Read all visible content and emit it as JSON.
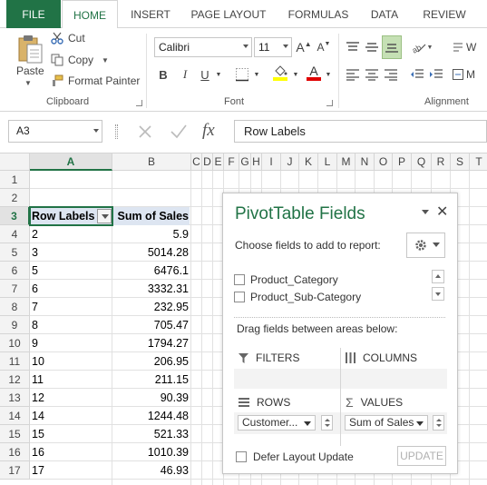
{
  "ribbon_tabs": [
    "FILE",
    "HOME",
    "INSERT",
    "PAGE LAYOUT",
    "FORMULAS",
    "DATA",
    "REVIEW"
  ],
  "active_tab": "HOME",
  "colors": {
    "accent": "#217346",
    "header_cell_fill": "#dde5f1",
    "font_color_bar": "#e00000",
    "highlight_bar": "#ffff00"
  },
  "clipboard": {
    "paste": "Paste",
    "cut": "Cut",
    "copy": "Copy",
    "format_painter": "Format Painter",
    "group_label": "Clipboard"
  },
  "font": {
    "name": "Calibri",
    "size": "11",
    "group_label": "Font",
    "bold": "B",
    "italic": "I",
    "underline": "U",
    "grow": "A",
    "shrink": "A",
    "font_color": "A"
  },
  "alignment": {
    "group_label": "Alignment",
    "wrap_partial": "W",
    "merge_partial": "M"
  },
  "formula_bar": {
    "name_box": "A3",
    "fx": "fx",
    "formula": "Row Labels"
  },
  "columns": [
    "A",
    "B",
    "C",
    "D",
    "E",
    "F",
    "G",
    "H",
    "I",
    "J",
    "K",
    "L",
    "M",
    "N",
    "O",
    "P",
    "Q",
    "R",
    "S",
    "T"
  ],
  "rows": [
    "1",
    "2",
    "3",
    "4",
    "5",
    "6",
    "7",
    "8",
    "9",
    "10",
    "11",
    "12",
    "13",
    "14",
    "15",
    "16",
    "17"
  ],
  "pivot": {
    "header": {
      "label": "Row Labels",
      "value": "Sum of Sales"
    },
    "rows": [
      {
        "label": "2",
        "value": "5.9"
      },
      {
        "label": "3",
        "value": "5014.28"
      },
      {
        "label": "5",
        "value": "6476.1"
      },
      {
        "label": "6",
        "value": "3332.31"
      },
      {
        "label": "7",
        "value": "232.95"
      },
      {
        "label": "8",
        "value": "705.47"
      },
      {
        "label": "9",
        "value": "1794.27"
      },
      {
        "label": "10",
        "value": "206.95"
      },
      {
        "label": "11",
        "value": "211.15"
      },
      {
        "label": "12",
        "value": "90.39"
      },
      {
        "label": "14",
        "value": "1244.48"
      },
      {
        "label": "15",
        "value": "521.33"
      },
      {
        "label": "16",
        "value": "1010.39"
      },
      {
        "label": "17",
        "value": "46.93"
      }
    ]
  },
  "pane": {
    "title": "PivotTable Fields",
    "close": "✕",
    "subtitle": "Choose fields to add to report:",
    "fields": [
      "Product_Category",
      "Product_Sub-Category"
    ],
    "drag_hint": "Drag fields between areas below:",
    "filters": "FILTERS",
    "columns": "COLUMNS",
    "rows": "ROWS",
    "values": "VALUES",
    "rows_item": "Customer...",
    "values_item": "Sum of Sales",
    "defer": "Defer Layout Update",
    "update": "UPDATE"
  }
}
